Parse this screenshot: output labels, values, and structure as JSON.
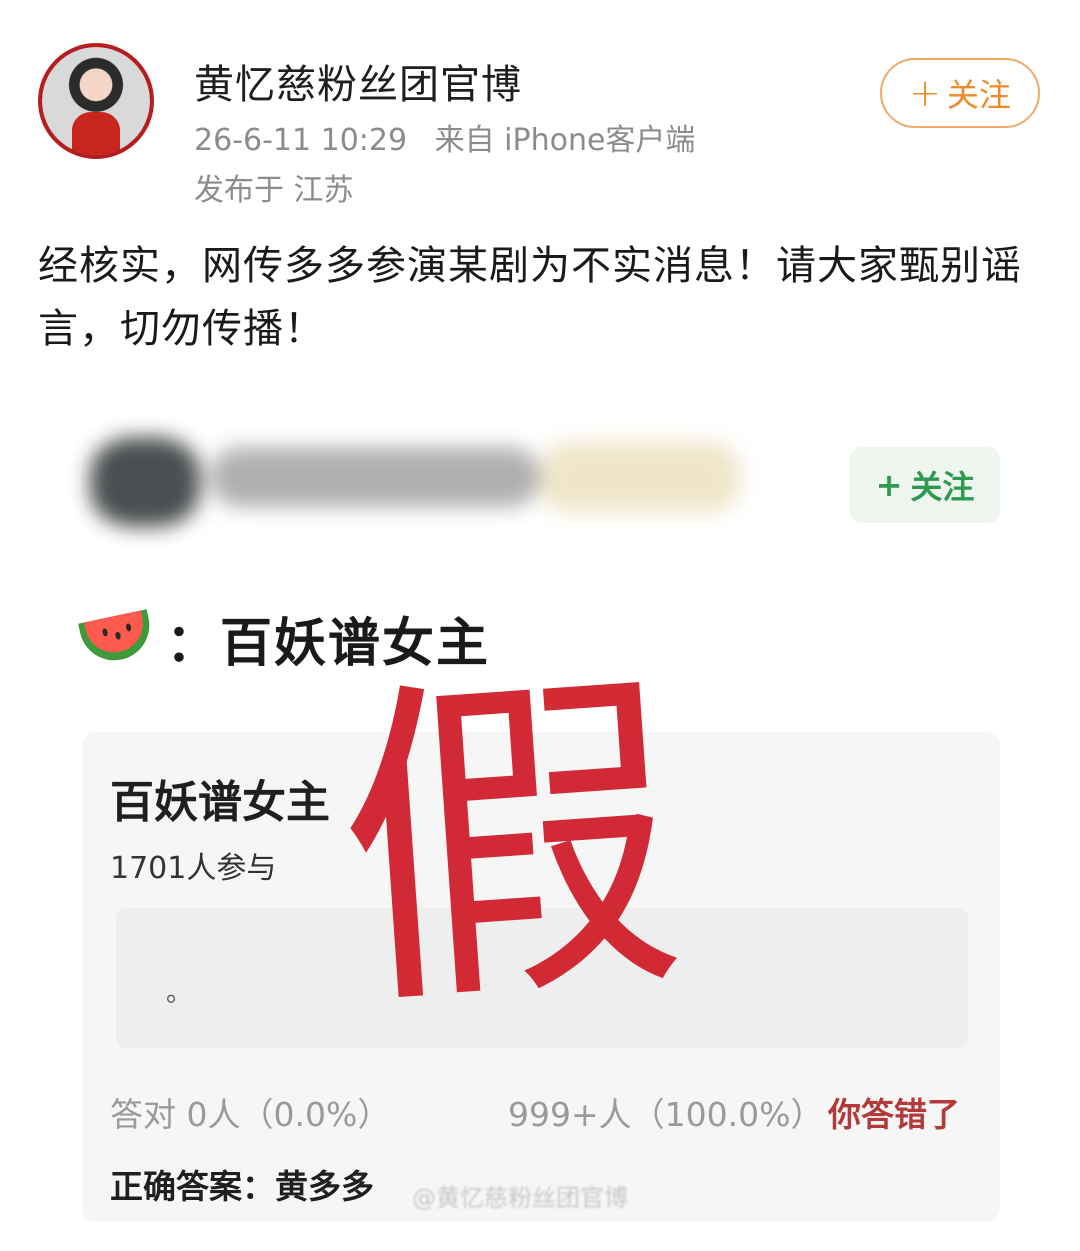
{
  "post": {
    "author_name": "黄忆慈粉丝团官博",
    "date": "26-6-11 10:29",
    "source": "来自 iPhone客户端",
    "location": "发布于 江苏",
    "follow_label": "关注",
    "text": "经核实，网传多多参演某剧为不实消息！请大家甄别谣言，切勿传播！"
  },
  "embedded": {
    "follow_label": "关注",
    "topic_icon": "watermelon-icon",
    "topic_text": "：百妖谱女主",
    "stamp_text": "假",
    "quiz": {
      "title": "百妖谱女主",
      "participants": "1701人参与",
      "answer_text": "。",
      "correct_stat": "答对  0人（0.0%）",
      "wrong_stat": "999+人（100.0%）",
      "wrong_label": "你答错了",
      "correct_answer": "正确答案：黄多多"
    },
    "watermark": "@黄忆慈粉丝团官博"
  },
  "colors": {
    "follow_orange": "#f08a2a",
    "follow_green": "#2e9a4f",
    "stamp_red": "#d0202c",
    "wrong_red": "#b23a3a"
  }
}
